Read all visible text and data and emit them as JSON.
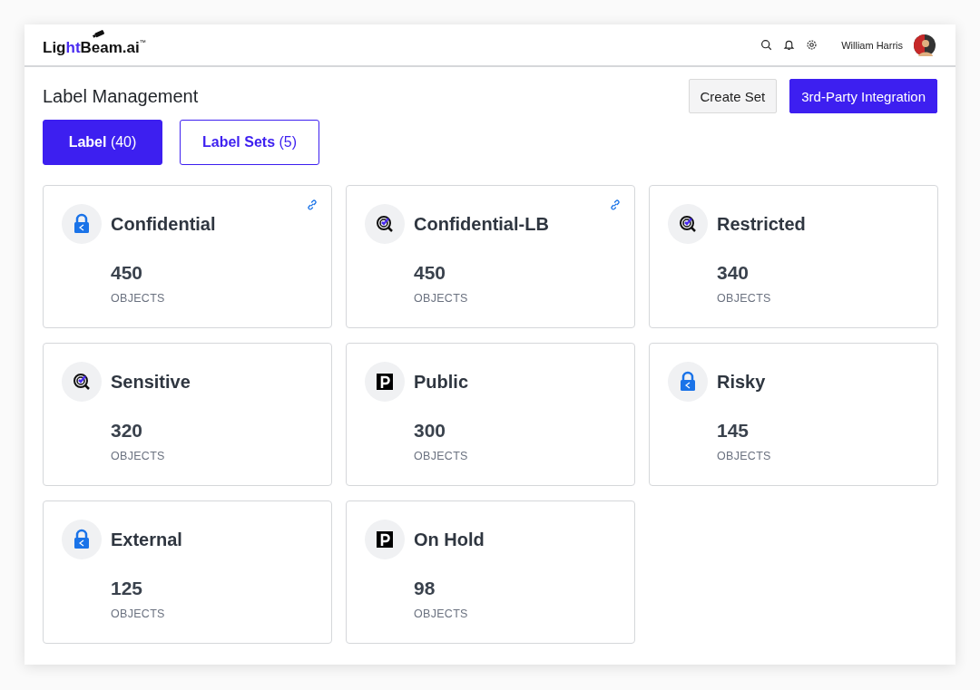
{
  "header": {
    "logo": {
      "before": "Lig",
      "highlight": "ht",
      "after": "Beam.ai",
      "mark": "™"
    },
    "user": {
      "name": "William Harris"
    }
  },
  "page": {
    "title": "Label Management",
    "actions": [
      {
        "label": "Create Set",
        "kind": "secondary"
      },
      {
        "label": "3rd-Party Integration",
        "kind": "primary"
      }
    ]
  },
  "tabs": [
    {
      "label": "Label",
      "count": "(40)",
      "selected": true
    },
    {
      "label": "Label Sets",
      "count": "(5)",
      "selected": false
    }
  ],
  "cards": [
    {
      "name": "Confidential",
      "kind": "lock",
      "linked": true,
      "count": "450",
      "unit": "OBJECTS"
    },
    {
      "name": "Confidential-LB",
      "kind": "fingerprint",
      "linked": true,
      "count": "450",
      "unit": "OBJECTS"
    },
    {
      "name": "Restricted",
      "kind": "fingerprint",
      "linked": false,
      "count": "340",
      "unit": "OBJECTS"
    },
    {
      "name": "Sensitive",
      "kind": "fingerprint",
      "linked": false,
      "count": "320",
      "unit": "OBJECTS"
    },
    {
      "name": "Public",
      "kind": "letter",
      "linked": false,
      "count": "300",
      "unit": "OBJECTS"
    },
    {
      "name": "Risky",
      "kind": "lock",
      "linked": false,
      "count": "145",
      "unit": "OBJECTS"
    },
    {
      "name": "External",
      "kind": "lock",
      "linked": false,
      "count": "125",
      "unit": "OBJECTS"
    },
    {
      "name": "On Hold",
      "kind": "letter",
      "linked": false,
      "count": "98",
      "unit": "OBJECTS"
    }
  ]
}
